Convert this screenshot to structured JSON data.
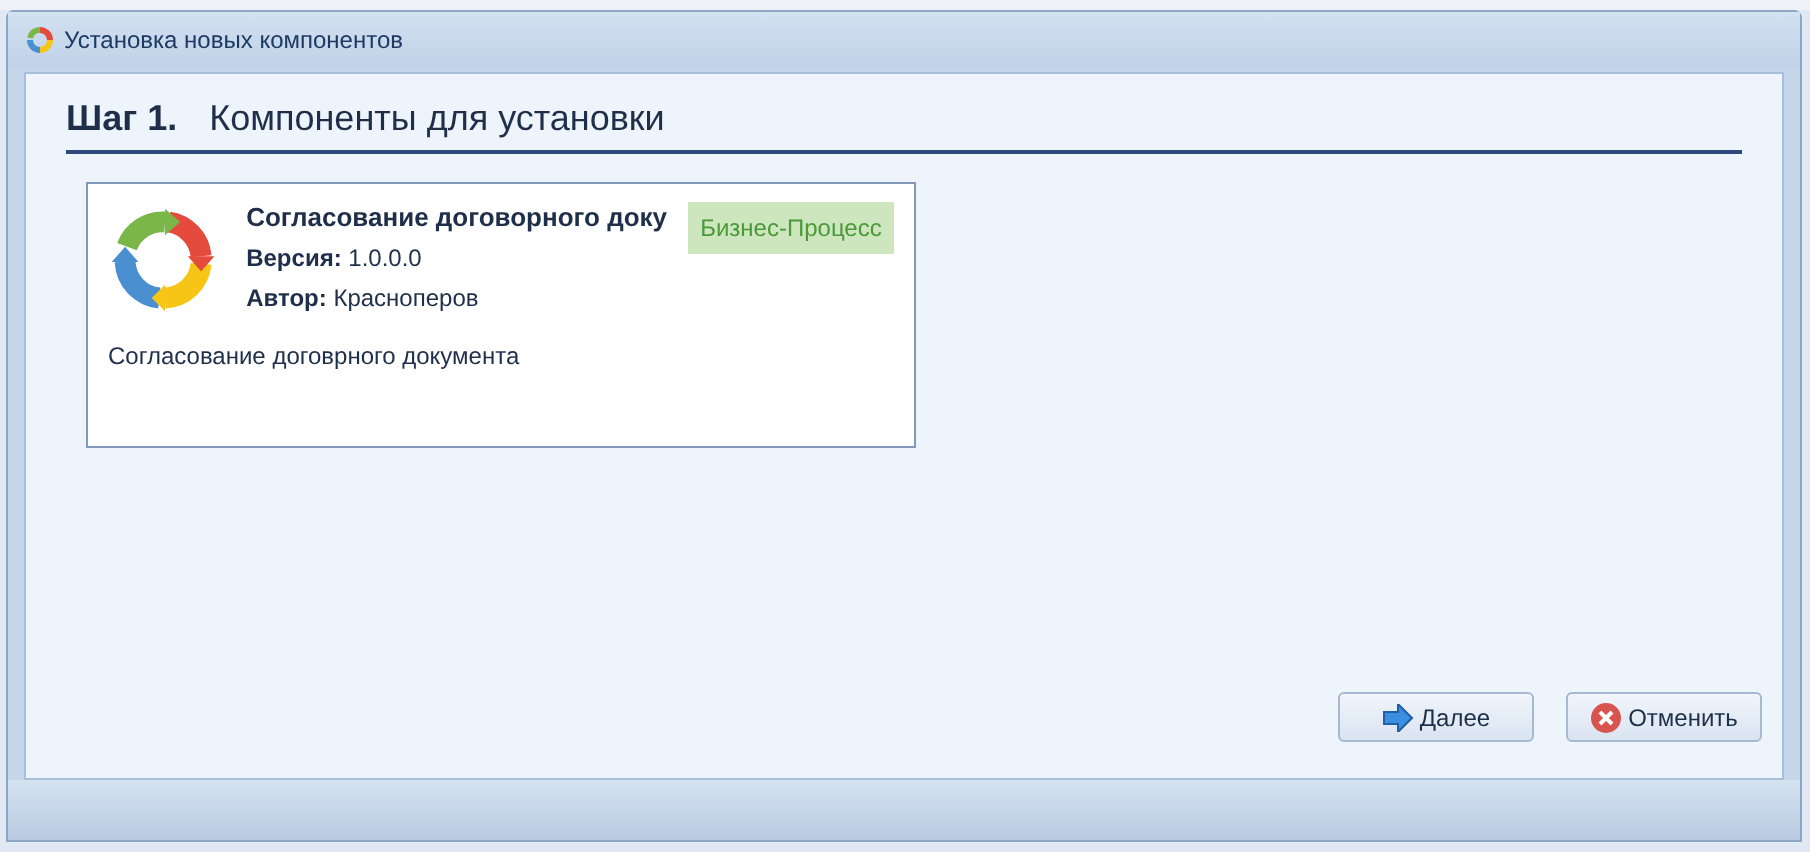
{
  "window": {
    "title": "Установка новых компонентов"
  },
  "step": {
    "number": "Шаг 1.",
    "title": "Компоненты для установки"
  },
  "components": [
    {
      "name": "Согласование договорного доку",
      "version_label": "Версия:",
      "version": "1.0.0.0",
      "author_label": "Автор:",
      "author": "Красноперов",
      "description": "Согласование договрного документа",
      "type": "Бизнес-Процесс"
    }
  ],
  "buttons": [
    {
      "kind": "next",
      "label": "Далее"
    },
    {
      "kind": "cancel",
      "label": "Отменить"
    }
  ]
}
